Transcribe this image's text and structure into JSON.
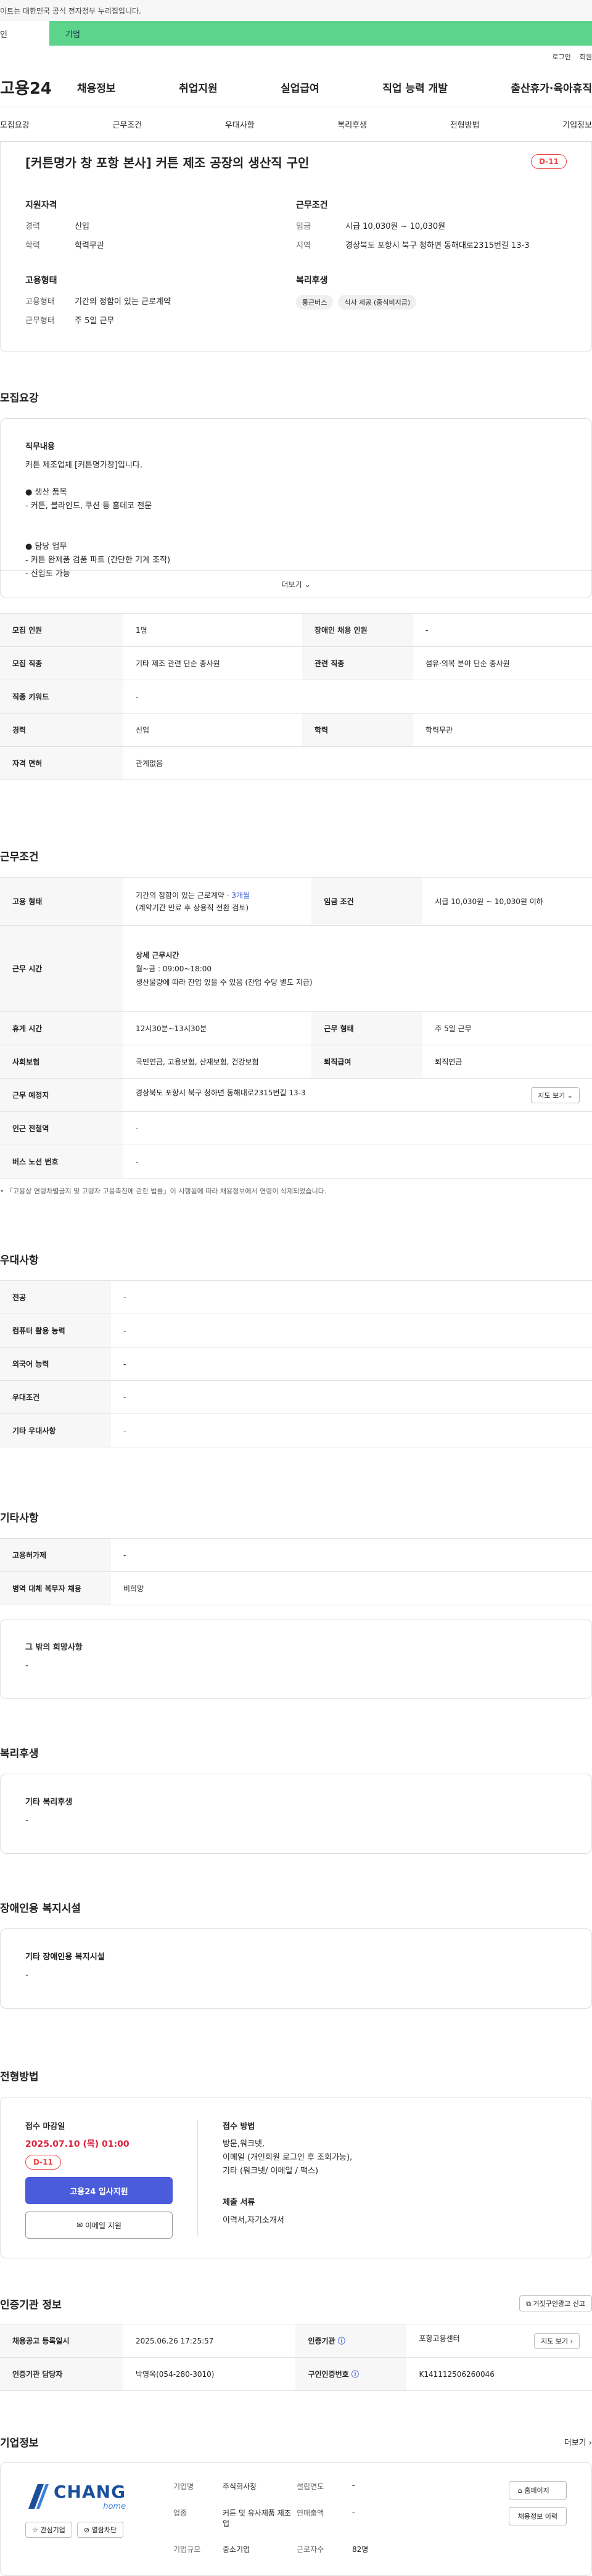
{
  "topbar": {
    "notice": "이트는 대한민국 공식 전자정부 누리집입니다."
  },
  "tabs": {
    "personal": "인",
    "company": "기업"
  },
  "util": {
    "login": "로그인",
    "join": "회원"
  },
  "gnb": {
    "logo": "고용24",
    "menu": [
      "채용정보",
      "취업지원",
      "실업급여",
      "직업 능력 개발",
      "출산휴가·육아휴직"
    ]
  },
  "subtabs": [
    "모집요강",
    "근무조건",
    "우대사항",
    "복리후생",
    "전형방법",
    "기업정보"
  ],
  "job": {
    "title": "[커튼명가 창 포항 본사] 커튼 제조 공장의 생산직 구인",
    "dday": "D-11",
    "qual_title": "지원자격",
    "qual": [
      {
        "k": "경력",
        "v": "신입"
      },
      {
        "k": "학력",
        "v": "학력무관"
      }
    ],
    "cond_title": "근무조건",
    "cond": [
      {
        "k": "임금",
        "v": "시급 10,030원 ~ 10,030원"
      },
      {
        "k": "지역",
        "v": "경상북도 포항시 북구 청하면 동해대로2315번길 13-3"
      }
    ],
    "emp_title": "고용형태",
    "emp": [
      {
        "k": "고용형태",
        "v": "기간의 정함이 있는 근로계약"
      },
      {
        "k": "근무형태",
        "v": "주 5일 근무"
      }
    ],
    "welfare_title": "복리후생",
    "welfare_chips": [
      "통근버스",
      "식사 제공 (중식비지급)"
    ]
  },
  "recruit": {
    "section": "모집요강",
    "duty_title": "직무내용",
    "duty_text": "커튼 제조업체 [커튼명가창]입니다.\n\n● 생산 품목\n - 커튼, 블라인드, 쿠션 등 홈데코 전문\n\n\n● 담당 업무\n - 커튼 완제품 검품 파트 (간단한 기계 조작)\n - 신입도 가능",
    "more": "더보기",
    "rows": [
      [
        "모집 인원",
        "1명",
        "장애인 채용 인원",
        "-"
      ],
      [
        "모집 직종",
        "기타 제조 관련 단순 종사원",
        "관련 직종",
        "섬유·의복 분야 단순 종사원"
      ],
      [
        "직종 키워드",
        "-",
        "",
        ""
      ],
      [
        "경력",
        "신입",
        "학력",
        "학력무관"
      ],
      [
        "자격 면허",
        "관계없음",
        "",
        ""
      ]
    ]
  },
  "work": {
    "section": "근무조건",
    "emp_label": "고용 형태",
    "emp_value": "기간의 정함이 있는 근로계약 ·",
    "emp_months": "3개월",
    "emp_sub": "(계약기간 만료 후 상용직 전환 검토)",
    "wage_label": "임금 조건",
    "wage_value": "시급 10,030원 ~ 10,030원 이하",
    "time_label": "근무 시간",
    "time_title": "상세 근무시간",
    "time_line1": "월~금 : 09:00~18:00",
    "time_line2": "생산물량에 따라 잔업 있을 수 있음 (잔업 수당 별도 지급)",
    "rows": [
      [
        "휴게 시간",
        "12시30분~13시30분",
        "근무 형태",
        "주 5일 근무"
      ],
      [
        "사회보험",
        "국민연금, 고용보험, 산재보험, 건강보험",
        "퇴직급여",
        "퇴직연금"
      ]
    ],
    "place_label": "근무 예정지",
    "place_value": "경상북도 포항시 북구 청하면 동해대로2315번길 13-3",
    "map_btn": "지도 보기",
    "station_label": "인근 전철역",
    "station_value": "-",
    "bus_label": "버스 노선 번호",
    "bus_value": "-",
    "note": "「고용상 연령차별금지 및 고령자 고용촉진에 관한 법률」이 시행됨에 따라 채용정보에서 연령이 삭제되었습니다."
  },
  "pref": {
    "section": "우대사항",
    "rows": [
      [
        "전공",
        "-"
      ],
      [
        "컴퓨터 활용 능력",
        "-"
      ],
      [
        "외국어 능력",
        "-"
      ],
      [
        "우대조건",
        "-"
      ],
      [
        "기타 우대사항",
        "-"
      ]
    ]
  },
  "etc": {
    "section": "기타사항",
    "rows": [
      [
        "고용허가제",
        "-"
      ],
      [
        "병역 대체 복무자 채용",
        "비희망"
      ]
    ],
    "hope_title": "그 밖의 희망사항",
    "hope_value": "-"
  },
  "welfare": {
    "section": "복리후생",
    "title": "기타 복리후생",
    "value": "-"
  },
  "disabled": {
    "section": "장애인용 복지시설",
    "title": "기타 장애인용 복지시설",
    "value": "-"
  },
  "apply": {
    "section": "전형방법",
    "deadline_title": "접수 마감일",
    "deadline": "2025.07.10 (목) 01:00",
    "dday": "D-11",
    "btn_apply": "고용24 입사지원",
    "btn_email": "이메일 지원",
    "method_title": "접수 방법",
    "method": "방문,워크넷,\n이메일 (개인회원 로그인 후 조회가능),\n기타 (워크넷/ 이메일 / 팩스)",
    "docs_title": "제출 서류",
    "docs": "이력서,자기소개서"
  },
  "agency": {
    "section": "인증기관 정보",
    "report_btn": "거짓구인광고 신고",
    "rows": [
      [
        "채용공고 등록일시",
        "2025.06.26 17:25:57",
        "인증기관",
        "포항고용센터"
      ],
      [
        "인증기관 담당자",
        "박영옥(054-280-3010)",
        "구인인증번호",
        "K141112506260046"
      ]
    ],
    "map_btn": "지도 보기"
  },
  "company": {
    "section": "기업정보",
    "more": "더보기",
    "logo_top": "CHANG",
    "logo_sub": "home",
    "fav": "관심기업",
    "block": "열람차단",
    "fields": [
      [
        "기업명",
        "주식회사창",
        "설립연도",
        "-"
      ],
      [
        "업종",
        "커튼 및 유사제품 제조업",
        "연매출액",
        "-"
      ],
      [
        "기업규모",
        "중소기업",
        "근로자수",
        "82명"
      ]
    ],
    "homepage": "홈페이지",
    "jobs": "채용정보 이력"
  }
}
